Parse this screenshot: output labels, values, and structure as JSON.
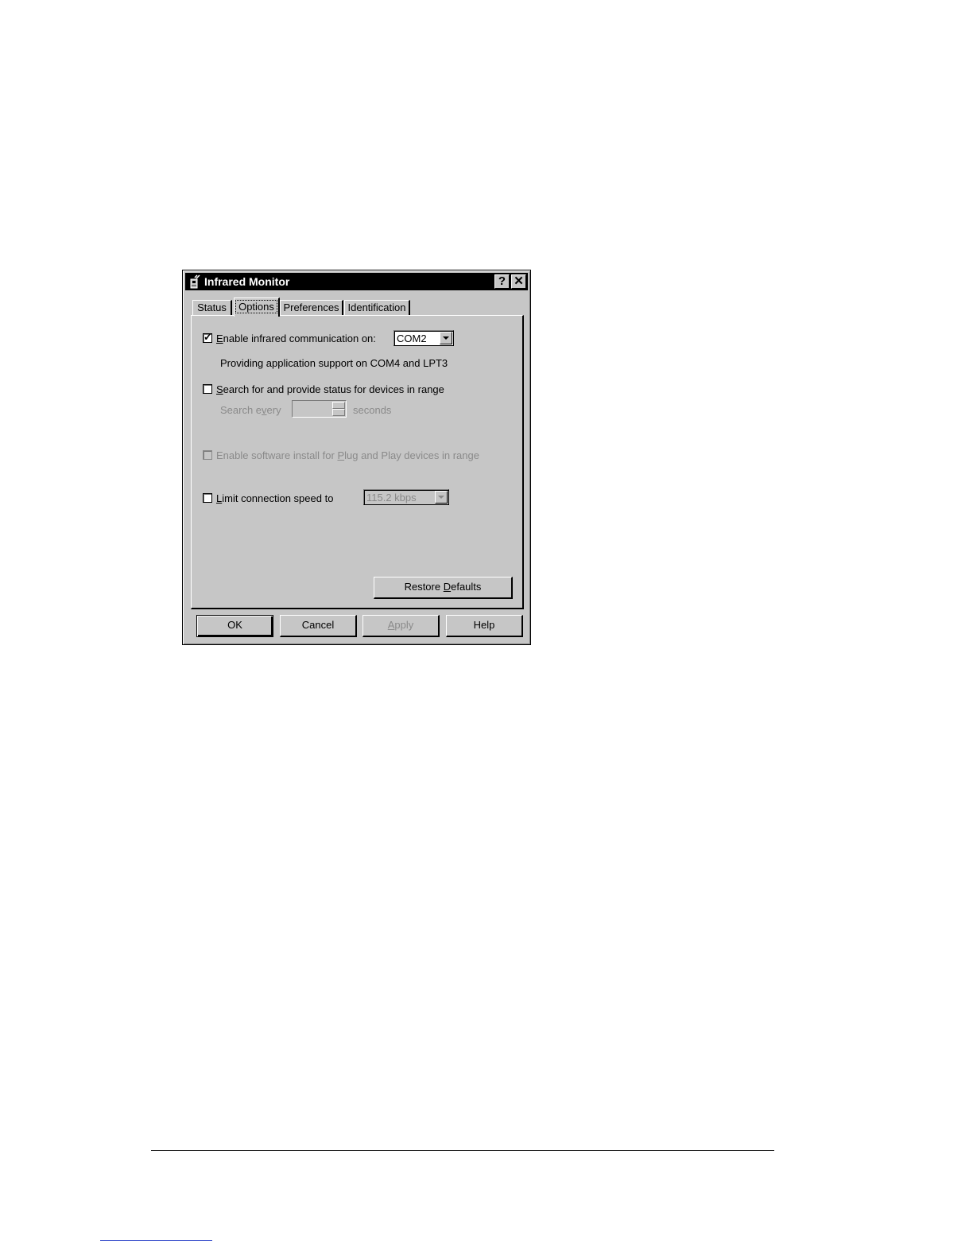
{
  "window": {
    "title": "Infrared Monitor",
    "help_glyph": "?",
    "close_glyph": "✕",
    "icon": "infrared-device-icon"
  },
  "tabs": [
    {
      "label": "Status",
      "active": false
    },
    {
      "label": "Options",
      "active": true
    },
    {
      "label": "Preferences",
      "active": false
    },
    {
      "label": "Identification",
      "active": false
    }
  ],
  "options": {
    "enable_ir": {
      "label_pre": "",
      "label_key": "E",
      "label_post": "nable infrared communication on:",
      "checked": true,
      "port_value": "COM2"
    },
    "support_text": "Providing application support on COM4 and LPT3",
    "search": {
      "label_pre": "",
      "label_key": "S",
      "label_post": "earch for and provide status for devices in range",
      "checked": false,
      "every_pre": "Search e",
      "every_key": "v",
      "every_post": "ery",
      "value": "",
      "unit": "seconds"
    },
    "pnp": {
      "label_pre": "Enable software install for ",
      "label_key": "P",
      "label_post": "lug and Play devices in range",
      "checked": false,
      "enabled": false
    },
    "limit_speed": {
      "label_pre": "",
      "label_key": "L",
      "label_post": "imit connection speed to",
      "checked": false,
      "speed_value": "115.2 kbps"
    },
    "restore_pre": "Restore ",
    "restore_key": "D",
    "restore_post": "efaults"
  },
  "buttons": {
    "ok": "OK",
    "cancel": "Cancel",
    "apply_key": "A",
    "apply_post": "pply",
    "help": "Help"
  },
  "colors": {
    "face": "#c6c6c6",
    "title_bar": "#000000",
    "disabled_text": "#8a8a8a"
  }
}
